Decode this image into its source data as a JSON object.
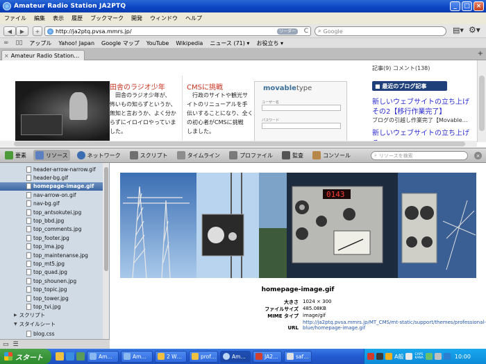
{
  "window": {
    "title": "Amateur Radio Station JA2PTQ",
    "minimize": "_",
    "maximize": "□",
    "close": "×"
  },
  "menu": [
    "ファイル",
    "編集",
    "表示",
    "履歴",
    "ブックマーク",
    "開発",
    "ウィンドウ",
    "ヘルプ"
  ],
  "nav": {
    "back": "◀",
    "forward": "▶",
    "add": "+",
    "url": "http://ja2ptq.pvsa.mmrs.jp/",
    "reader": "リーダー",
    "reload": "C",
    "search_placeholder": "Google"
  },
  "bookmarks": [
    "アップル",
    "Yahoo! Japan",
    "Google マップ",
    "YouTube",
    "Wikipedia",
    "ニュース (71) ▾",
    "お役立ち ▾"
  ],
  "tab": {
    "title": "Amateur Radio Station…",
    "close": "×"
  },
  "page": {
    "col1_head": "田舎のラジオ少年",
    "col1_lines": [
      "田舎のラジオ少年が、",
      "怖いもの知らずというか、",
      "無知と言おうか、よく分か",
      "らずにイロイロやっていま",
      "した。"
    ],
    "col2_head": "CMSに挑戦",
    "col2_lines": [
      "行政のサイトや観光サ",
      "イトのリニューアルを手",
      "伝いすることになり、全く",
      "の初心者がCMSに挑戦",
      "しました。"
    ],
    "mt_logo_prefix": "movable",
    "mt_logo_suffix": "type",
    "mt_username": "ユーザー名",
    "mt_password": "パスワード",
    "side_top": "記事(9) コメント(138)",
    "side_head": "■ 最近のブログ記事",
    "side_link1": "新しいウェブサイトの立ち上げ",
    "side_link1b": "その2【移行作業完了】",
    "side_small1": "ブログの引越し作業完了【Movable…",
    "side_link2": "新しいウェブサイトの立ち上げ そ"
  },
  "inspector": {
    "tabs": [
      "要素",
      "リソース",
      "ネットワーク",
      "スクリプト",
      "タイムライン",
      "プロファイル",
      "監査",
      "コンソール"
    ],
    "active_tab": "リソース",
    "search_placeholder": "リソースを検索"
  },
  "resources": {
    "files": [
      "header-arrow-narrow.gif",
      "header-bg.gif",
      "homepage-image.gif",
      "nav-arrow-on.gif",
      "nav-bg.gif",
      "top_antsokutei.jpg",
      "top_bbd.jpg",
      "top_comments.jpg",
      "top_footer.jpg",
      "top_lma.jpg",
      "top_maintenanse.jpg",
      "top_mt5.jpg",
      "top_quad.jpg",
      "top_shounen.jpg",
      "top_topic.jpg",
      "top_tower.jpg",
      "top_tvi.jpg"
    ],
    "selected_index": 2,
    "group_scripts": "スクリプト",
    "group_styles": "スタイルシート",
    "style_file": "blog.css"
  },
  "preview": {
    "title": "homepage-image.gif",
    "meter_readout": "0143",
    "meta": [
      {
        "key": "大きさ",
        "value": "1024 × 300"
      },
      {
        "key": "ファイルサイズ",
        "value": "485.08KB"
      },
      {
        "key": "MIME タイプ",
        "value": "image/gif"
      },
      {
        "key": "URL",
        "value": "http://ja2ptq.pvsa.mmrs.jp/MT_CMS/mt-static/support/themes/professional-",
        "value2": "blue/homepage-image.gif"
      }
    ]
  },
  "taskbar": {
    "start": "スタート",
    "tasks": [
      "Am…",
      "Am…",
      "2 W…",
      "prof…",
      "Am…",
      "JA2…",
      "saf…"
    ],
    "ime": "A般",
    "caps": "CAPS",
    "num": "KANA",
    "clock": "10:00"
  },
  "colors": {
    "title_bar": "#0b45c4",
    "accent_red": "#c8311f",
    "link_blue": "#2b2bd1",
    "selected_row": "#3f68a5",
    "taskbar": "#235bd0"
  }
}
